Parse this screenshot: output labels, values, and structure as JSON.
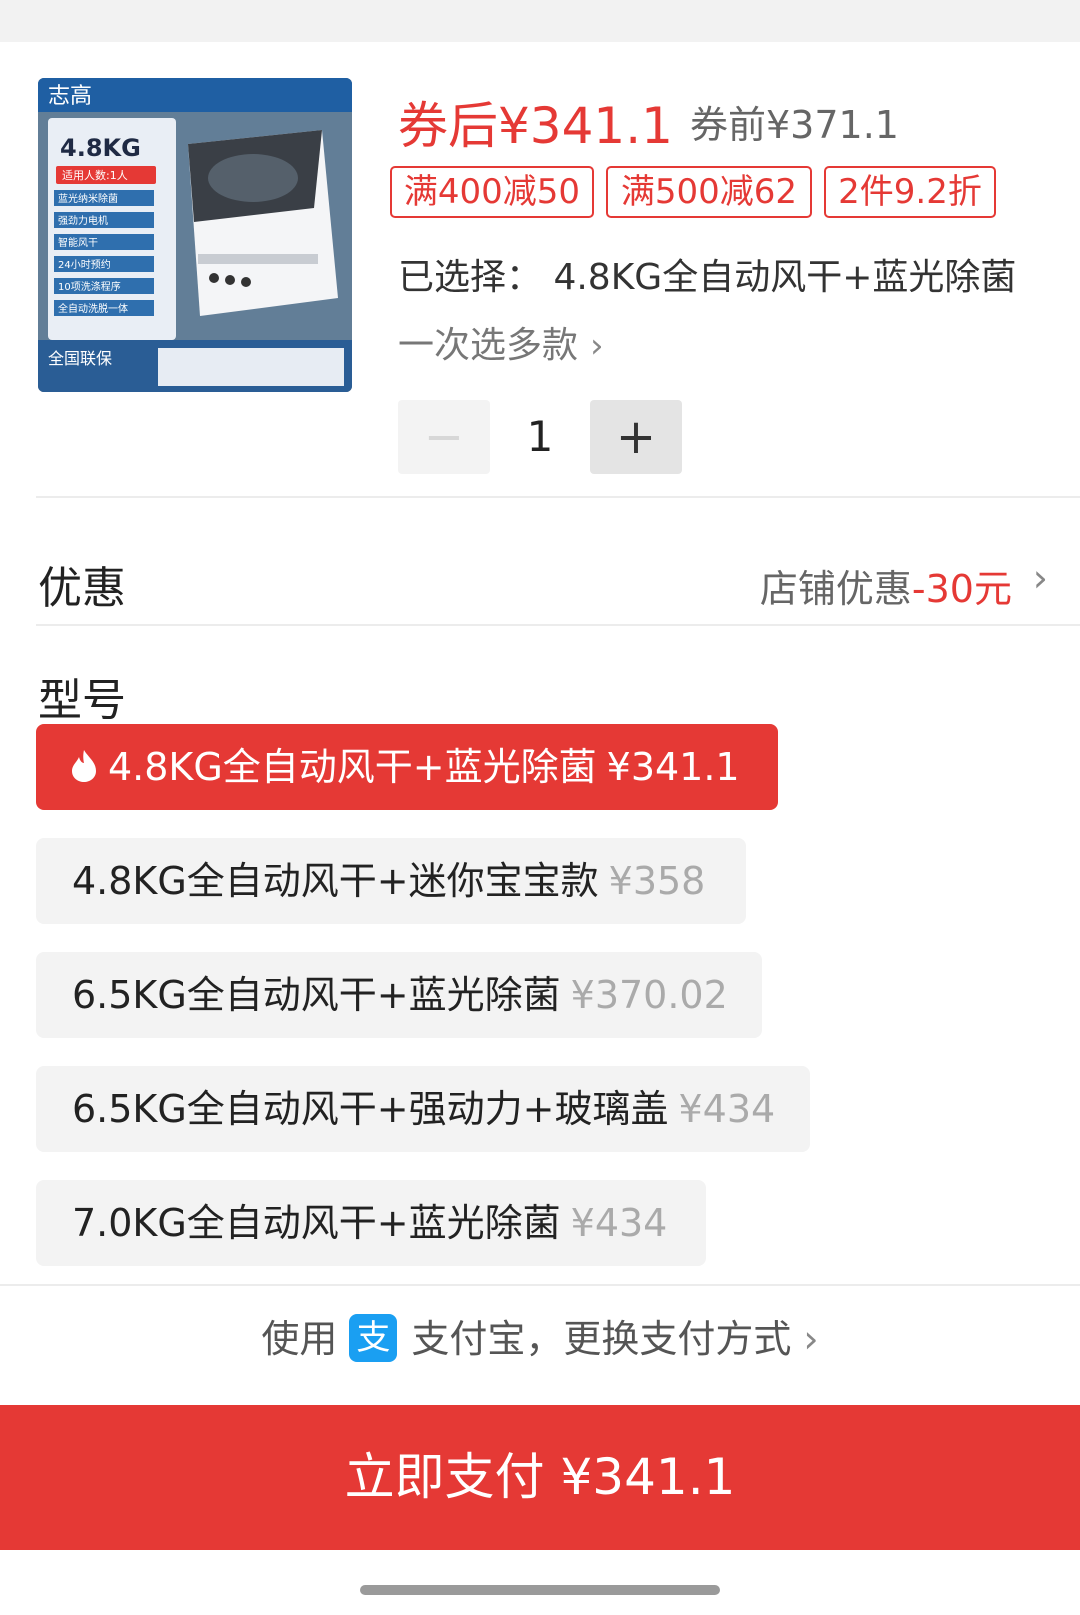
{
  "product": {
    "image_alt": "志高 4.8KG washing machine",
    "brand_logo": "志高",
    "capacity_badge": "4.8KG",
    "people_tag": "适用人数:1人",
    "features": [
      "蓝光纳米除菌",
      "强劲力电机",
      "智能风干",
      "24小时预约",
      "10项洗涤程序",
      "全自动洗脱一体"
    ],
    "warranty": "全国联保",
    "price_after_coupon": "券后¥341.1",
    "price_before_coupon": "券前¥371.1",
    "promotions": [
      "满400减50",
      "满500减62",
      "2件9.2折"
    ],
    "selected_text": "已选择： 4.8KG全自动风干+蓝光除菌",
    "multi_select_text": "一次选多款",
    "quantity": "1"
  },
  "discount": {
    "label": "优惠",
    "value_prefix": "店铺优惠",
    "value_amount": "-30元"
  },
  "model": {
    "label": "型号",
    "options": [
      {
        "name": "4.8KG全自动风干+蓝光除菌",
        "price": "¥341.1",
        "selected": true
      },
      {
        "name": "4.8KG全自动风干+迷你宝宝款",
        "price": "¥358",
        "selected": false
      },
      {
        "name": "6.5KG全自动风干+蓝光除菌",
        "price": "¥370.02",
        "selected": false
      },
      {
        "name": "6.5KG全自动风干+强动力+玻璃盖",
        "price": "¥434",
        "selected": false
      },
      {
        "name": "7.0KG全自动风干+蓝光除菌",
        "price": "¥434",
        "selected": false
      }
    ]
  },
  "payment": {
    "prefix": "使用",
    "method": "支付宝，更换支付方式",
    "pay_button": "立即支付 ¥341.1"
  },
  "colors": {
    "accent": "#e53935",
    "alipay": "#1a9ff2"
  }
}
